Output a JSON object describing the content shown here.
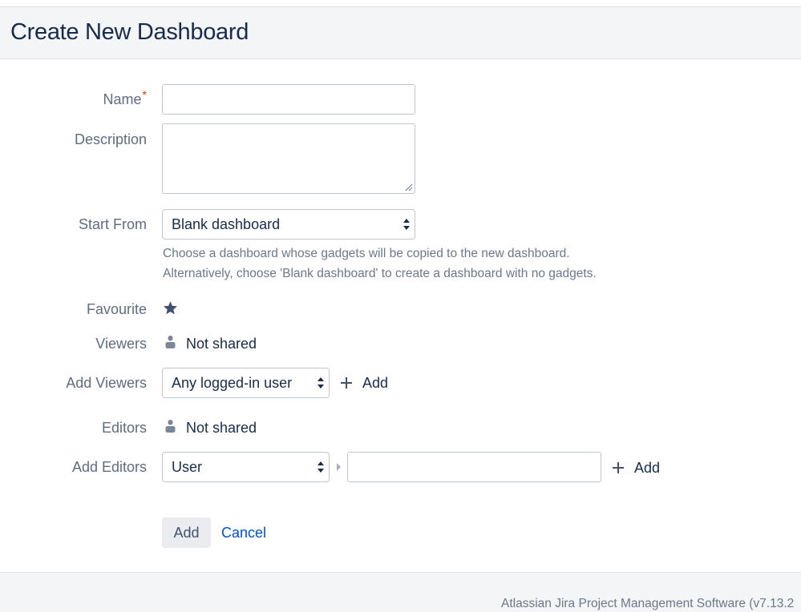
{
  "page": {
    "title": "Create New Dashboard"
  },
  "form": {
    "name": {
      "label": "Name",
      "required_marker": "*",
      "value": ""
    },
    "description": {
      "label": "Description",
      "value": ""
    },
    "start_from": {
      "label": "Start From",
      "selected": "Blank dashboard",
      "hint_line1": "Choose a dashboard whose gadgets will be copied to the new dashboard.",
      "hint_line2": "Alternatively, choose 'Blank dashboard' to create a dashboard with no gadgets."
    },
    "favourite": {
      "label": "Favourite",
      "icon": "star-icon",
      "checked": true
    },
    "viewers": {
      "label": "Viewers",
      "value": "Not shared",
      "icon": "person-icon"
    },
    "add_viewers": {
      "label": "Add Viewers",
      "selected": "Any logged-in user",
      "add_label": "Add"
    },
    "editors": {
      "label": "Editors",
      "value": "Not shared",
      "icon": "person-icon"
    },
    "add_editors": {
      "label": "Add Editors",
      "selected": "User",
      "input_value": "",
      "add_label": "Add"
    }
  },
  "actions": {
    "submit": "Add",
    "cancel": "Cancel"
  },
  "footer": {
    "text": "Atlassian Jira Project Management Software (v7.13.2"
  },
  "colors": {
    "link": "#0052cc",
    "required": "#de350b",
    "label": "#5e6c84",
    "text": "#172b4d"
  }
}
